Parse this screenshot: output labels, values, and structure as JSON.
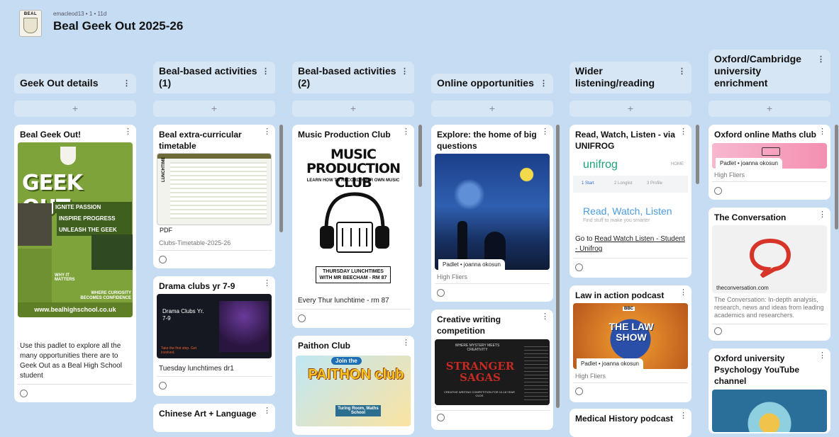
{
  "header": {
    "meta": "emacleod13 • 1 • 11d",
    "title": "Beal Geek Out 2025-26",
    "logo_text": "BEAL"
  },
  "add_symbol": "+",
  "menu_symbol": "⋮",
  "columns": [
    {
      "title": "Geek Out details",
      "cards": [
        {
          "title": "Beal Geek Out!",
          "text": "Use this padlet to explore all the many opportunities there are to Geek Out as a Beal High School student",
          "poster": {
            "title": "GEEK OUT",
            "lines": [
              "IGNITE PASSION",
              "INSPIRE PROGRESS",
              "UNLEASH THE GEEK"
            ],
            "why": "WHY IT MATTERS",
            "curiosity": "WHERE CURIOSITY BECOMES CONFIDENCE",
            "site": "www.bealhighschool.co.uk"
          }
        }
      ]
    },
    {
      "title": "Beal-based activities (1)",
      "cards": [
        {
          "title": "Beal extra-curricular timetable",
          "attachment_type": "PDF",
          "attachment_name": "Clubs-Timetable-2025-26",
          "img_label": "LUNCHTIME"
        },
        {
          "title": "Drama clubs yr 7-9",
          "img_title": "Drama Clubs Yr. 7-9",
          "img_cta": "Take the first step. Get involved.",
          "text": "Tuesday lunchtimes dr1"
        },
        {
          "title": "Chinese Art + Language"
        }
      ]
    },
    {
      "title": "Beal-based activities (2)",
      "cards": [
        {
          "title": "Music Production Club",
          "img_title": "MUSIC PRODUCTION CLUB",
          "img_sub": "LEARN HOW TO RECORD YOUR OWN MUSIC",
          "img_box": "THURSDAY LUNCHTIMES WITH MR BEECHAM - RM 87",
          "text": "Every Thur lunchtime - rm 87"
        },
        {
          "title": "Paithon Club",
          "img_top": "Join the",
          "img_title": "PAITHON club",
          "img_sub": "Turing Room, Maths School"
        }
      ]
    },
    {
      "title": "Online opportunities",
      "cards": [
        {
          "title": "Explore: the home of big questions",
          "chip": "Padlet • joanna okosun",
          "source": "High Fliers"
        },
        {
          "title": "Creative writing competition",
          "img_top": "WHERE MYSTERY MEETS CREATIVITY",
          "img_title": "STRANGER SAGAS",
          "img_sub": "CREATIVE WRITING COMPETITION FOR 10-18 YEAR OLDS"
        }
      ]
    },
    {
      "title": "Wider listening/reading",
      "cards": [
        {
          "title": "Read, Watch, Listen - via UNIFROG",
          "brand": "unifrog",
          "nav": "HOME",
          "steps": [
            "1 Start",
            "2 Longlist",
            "3 Profile"
          ],
          "heading": "Read, Watch, Listen",
          "tagline": "Find stuff to make you smarter",
          "text_prefix": "Go to ",
          "link": "Read Watch Listen - Student - Unifrog"
        },
        {
          "title": "Law in action podcast",
          "img_title": "THE LAW SHOW",
          "img_badge": "BBC",
          "chip": "Padlet • joanna okosun",
          "source": "High Fliers"
        },
        {
          "title": "Medical History podcast"
        }
      ]
    },
    {
      "title": "Oxford/Cambridge university enrichment",
      "cards": [
        {
          "title": "Oxford online Maths club",
          "chip": "Padlet • joanna okosun",
          "source": "High Fliers"
        },
        {
          "title": "The Conversation",
          "domain": "theconversation.com",
          "desc": "The Conversation: In-depth analysis, research, news and ideas from leading academics and researchers."
        },
        {
          "title": "Oxford university Psychology YouTube channel"
        }
      ]
    }
  ],
  "colors": {
    "background": "#c6dcf2",
    "header_bg": "#d7e6f5",
    "card_bg": "#ffffff",
    "poster_green": "#7da33a",
    "conversation_red": "#d8352a"
  }
}
